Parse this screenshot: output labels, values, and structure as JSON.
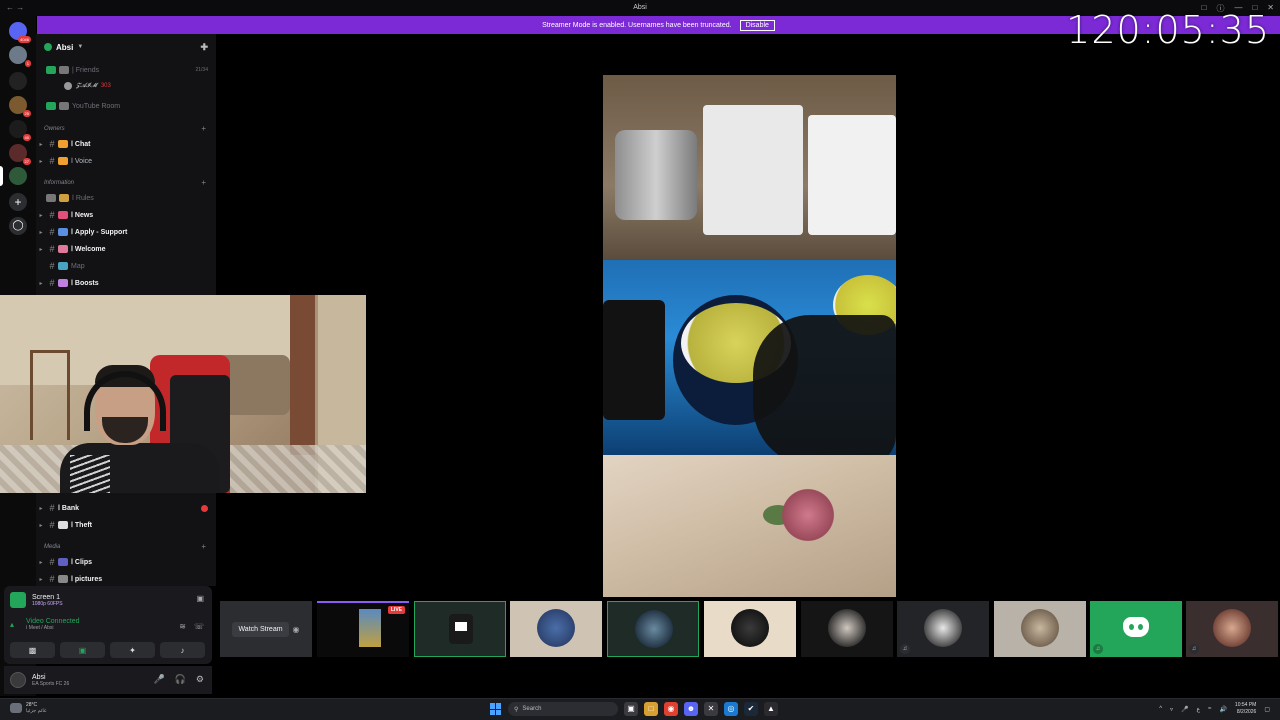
{
  "window": {
    "title": "Absi",
    "nav": "← →",
    "controls": [
      "□",
      "ⓘ",
      "—",
      "□",
      "✕"
    ]
  },
  "banner": {
    "text": "Streamer Mode is enabled. Usernames have been truncated.",
    "button": "Disable"
  },
  "timer": "120:05:35",
  "server_rail": {
    "badges": [
      "4046",
      "1",
      "25",
      "40",
      "27"
    ]
  },
  "guild": {
    "name": "Absi",
    "invite_icon": "person-add-icon"
  },
  "channels": {
    "friends": {
      "label": "| Friends",
      "count": "21/34"
    },
    "friend_user": {
      "name": "𝓩𝓐𝓘𝓜",
      "tag": "303"
    },
    "youtube": {
      "label": "YouTube Room"
    },
    "cat_owners": "Owners",
    "chat": {
      "label": "ا Chat"
    },
    "voice": {
      "label": "ا Voice"
    },
    "cat_information": "Information",
    "rules": {
      "label": "ا Rules"
    },
    "news": {
      "label": "ا News"
    },
    "apply": {
      "label": "ا Apply - Support"
    },
    "welcome": {
      "label": "ا Welcome"
    },
    "map": {
      "label": "Map"
    },
    "boosts": {
      "label": "ا Boosts"
    },
    "bank": {
      "label": "ا Bank"
    },
    "theft": {
      "label": "ا Theft"
    },
    "cat_media": "Media",
    "clips": {
      "label": "ا Clips"
    },
    "pictures": {
      "label": "ا pictures"
    }
  },
  "voice_panel": {
    "screen_title": "Screen 1",
    "screen_sub": "1080p 60FPS",
    "connected": "Video Connected",
    "connected_sub": "ا Meet / Absi"
  },
  "user": {
    "name": "Absi",
    "status": "EA Sports FC 26"
  },
  "tiles": {
    "watch_label": "Watch Stream",
    "live_label": "LIVE"
  },
  "taskbar": {
    "temp": "28°C",
    "weather_text": "غائم جزئيا",
    "search_placeholder": "Search",
    "time": "10:54 PM",
    "date": "8/2/2026"
  },
  "colors": {
    "accent": "#7b2ad6",
    "green": "#23a55a",
    "red": "#e23b3b"
  }
}
